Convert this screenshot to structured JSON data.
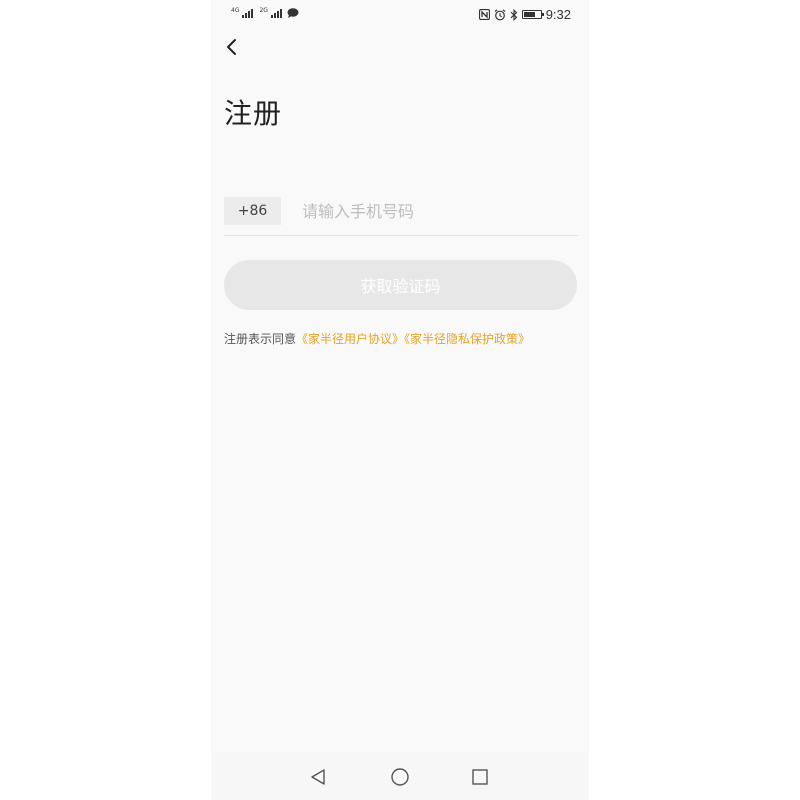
{
  "status_bar": {
    "net1": "4G",
    "net2": "2G",
    "time": "9:32",
    "battery_level": 0.7
  },
  "page": {
    "title": "注册"
  },
  "phone_form": {
    "country_code": "+86",
    "phone_placeholder": "请输入手机号码",
    "phone_value": ""
  },
  "get_code_button": {
    "label": "获取验证码",
    "enabled": false
  },
  "agreement": {
    "prefix": "注册表示同意",
    "user_agreement": "《家半径用户协议》",
    "privacy_policy": "《家半径隐私保护政策》"
  },
  "colors": {
    "link": "#e5a322",
    "button_disabled": "#e7e7e7",
    "background": "#f9f9f9"
  },
  "icons": {
    "back": "chevron-left-icon",
    "nav_back": "triangle-back-icon",
    "nav_home": "circle-home-icon",
    "nav_recent": "square-recent-icon"
  }
}
